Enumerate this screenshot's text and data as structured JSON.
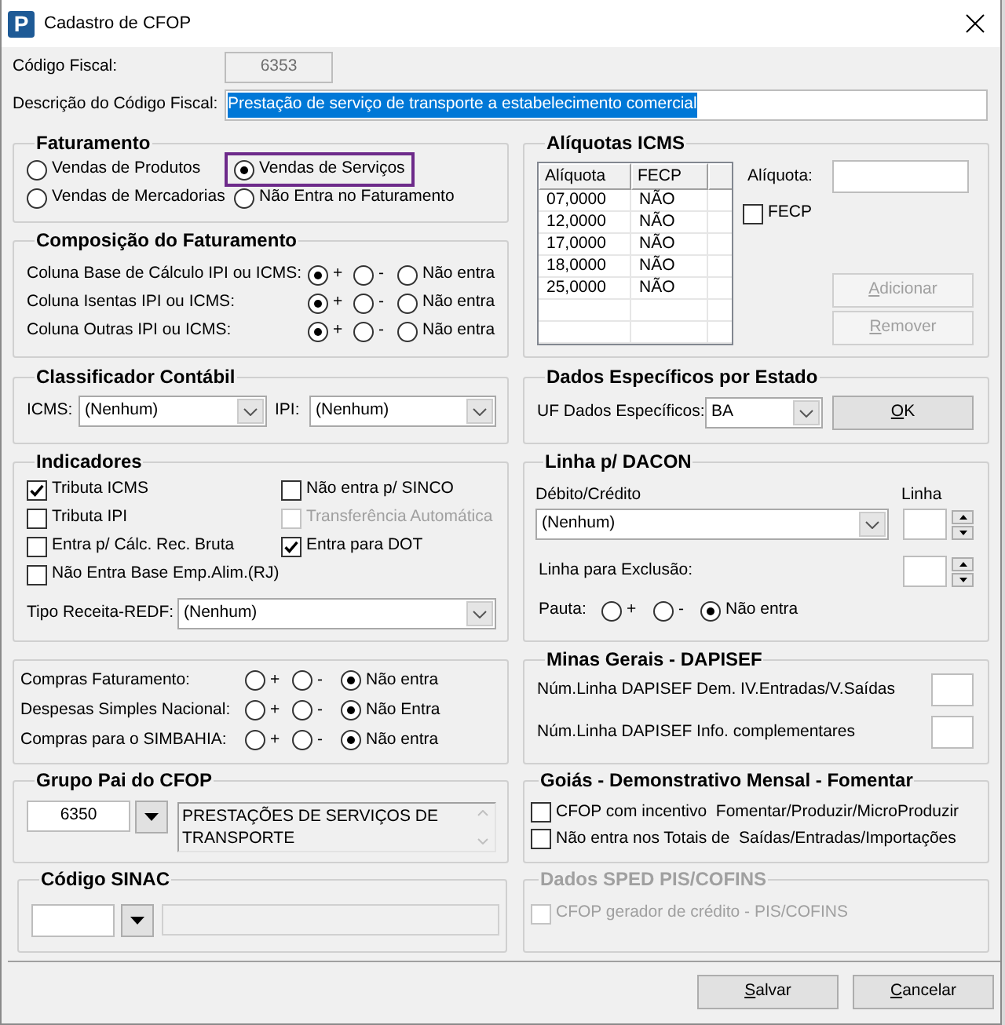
{
  "window": {
    "logo": "P",
    "title": "Cadastro de CFOP"
  },
  "codigo_fiscal": {
    "label": "Código Fiscal:",
    "value": "6353",
    "disabled": true
  },
  "descricao": {
    "label": "Descrição do Código Fiscal:",
    "value": "Prestação de serviço de transporte a estabelecimento comercial",
    "highlighted": true
  },
  "faturamento": {
    "title": "Faturamento",
    "options": [
      {
        "label": "Vendas de Produtos",
        "selected": false,
        "outlined": false
      },
      {
        "label": "Vendas de Serviços",
        "selected": true,
        "outlined": true
      },
      {
        "label": "Vendas de Mercadorias",
        "selected": false,
        "outlined": false
      },
      {
        "label": "Não Entra no Faturamento",
        "selected": false,
        "outlined": false
      }
    ]
  },
  "composicao": {
    "title": "Composição do Faturamento",
    "rows": [
      {
        "label": "Coluna Base de Cálculo IPI ou ICMS:",
        "options": [
          {
            "label": "+",
            "selected": true
          },
          {
            "label": "-",
            "selected": false
          },
          {
            "label": "Não entra",
            "selected": false
          }
        ]
      },
      {
        "label": "Coluna Isentas IPI ou ICMS:",
        "options": [
          {
            "label": "+",
            "selected": true
          },
          {
            "label": "-",
            "selected": false
          },
          {
            "label": "Não entra",
            "selected": false
          }
        ]
      },
      {
        "label": "Coluna Outras IPI ou ICMS:",
        "options": [
          {
            "label": "+",
            "selected": true
          },
          {
            "label": "-",
            "selected": false
          },
          {
            "label": "Não entra",
            "selected": false
          }
        ]
      }
    ]
  },
  "classificador": {
    "title": "Classificador Contábil",
    "fields": [
      {
        "label": "ICMS:",
        "value": "(Nenhum)"
      },
      {
        "label": "IPI:",
        "value": "(Nenhum)"
      }
    ]
  },
  "indicadores": {
    "title": "Indicadores",
    "checkboxes": [
      {
        "label": "Tributa ICMS",
        "checked": true,
        "disabled": false
      },
      {
        "label": "Não entra p/ SINCO",
        "checked": false,
        "disabled": false
      },
      {
        "label": "Tributa IPI",
        "checked": false,
        "disabled": false
      },
      {
        "label": "Transferência Automática",
        "checked": false,
        "disabled": true
      },
      {
        "label": "Entra p/ Cálc. Rec. Bruta",
        "checked": false,
        "disabled": false
      },
      {
        "label": "Entra para DOT",
        "checked": true,
        "disabled": false
      },
      {
        "label": "Não Entra Base Emp.Alim.(RJ)",
        "checked": false,
        "disabled": false
      }
    ],
    "tipo_receita": {
      "label": "Tipo Receita-REDF:",
      "value": "(Nenhum)"
    }
  },
  "compras": {
    "rows": [
      {
        "label": "Compras Faturamento:",
        "options": [
          {
            "label": "+",
            "selected": false
          },
          {
            "label": "-",
            "selected": false
          },
          {
            "label": "Não entra",
            "selected": true
          }
        ]
      },
      {
        "label": "Despesas Simples Nacional:",
        "options": [
          {
            "label": "+",
            "selected": false
          },
          {
            "label": "-",
            "selected": false
          },
          {
            "label": "Não Entra",
            "selected": true
          }
        ]
      },
      {
        "label": "Compras para o SIMBAHIA:",
        "options": [
          {
            "label": "+",
            "selected": false
          },
          {
            "label": "-",
            "selected": false
          },
          {
            "label": "Não entra",
            "selected": true
          }
        ]
      }
    ]
  },
  "grupo_pai": {
    "title": "Grupo Pai do CFOP",
    "code": "6350",
    "description": "PRESTAÇÕES DE SERVIÇOS DE TRANSPORTE"
  },
  "codigo_sinac": {
    "title": "Código SINAC"
  },
  "aliquotas": {
    "title": "Alíquotas ICMS",
    "table": {
      "columns": [
        "Alíquota",
        "FECP"
      ],
      "rows": [
        [
          "07,0000",
          "NÃO"
        ],
        [
          "12,0000",
          "NÃO"
        ],
        [
          "17,0000",
          "NÃO"
        ],
        [
          "18,0000",
          "NÃO"
        ],
        [
          "25,0000",
          "NÃO"
        ]
      ]
    },
    "field_label": "Alíquota:",
    "fecp": {
      "label": "FECP",
      "checked": false
    },
    "buttons": [
      {
        "label": "Adicionar",
        "disabled": true
      },
      {
        "label": "Remover",
        "disabled": true
      }
    ]
  },
  "dados_estado": {
    "title": "Dados Específicos por Estado",
    "label": "UF Dados Específicos:",
    "value": "BA",
    "button": "OK"
  },
  "dacon": {
    "title": "Linha p/ DACON",
    "debito_label": "Débito/Crédito",
    "debito_value": "(Nenhum)",
    "linha_label": "Linha",
    "exclusao_label": "Linha para Exclusão:",
    "pauta": {
      "label": "Pauta:",
      "options": [
        {
          "label": "+",
          "selected": false
        },
        {
          "label": "-",
          "selected": false
        },
        {
          "label": "Não entra",
          "selected": true
        }
      ]
    }
  },
  "dapisef": {
    "title": "Minas Gerais - DAPISEF",
    "rows": [
      "Núm.Linha DAPISEF Dem. IV.Entradas/V.Saídas",
      "Núm.Linha DAPISEF Info. complementares"
    ]
  },
  "goias": {
    "title": "Goiás - Demonstrativo Mensal - Fomentar",
    "checkboxes": [
      {
        "label": "CFOP com incentivo  Fomentar/Produzir/MicroProduzir",
        "checked": false
      },
      {
        "label": "Não entra nos Totais de  Saídas/Entradas/Importações",
        "checked": false
      }
    ]
  },
  "sped": {
    "title": "Dados SPED PIS/COFINS",
    "disabled": true,
    "checkboxes": [
      {
        "label": "CFOP gerador de crédito - PIS/COFINS",
        "checked": false
      }
    ]
  },
  "buttons": [
    {
      "label": "Salvar"
    },
    {
      "label": "Cancelar"
    }
  ]
}
